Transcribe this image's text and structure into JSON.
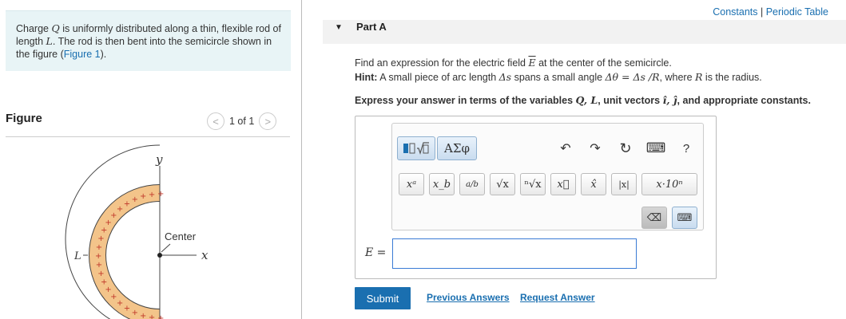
{
  "intro": {
    "t1": "Charge ",
    "q": "Q",
    "t2": " is uniformly distributed along a thin, flexible rod of length ",
    "l": "L",
    "t3": ". The rod is then bent into the semicircle shown in the figure (",
    "link": "Figure 1",
    "t4": ")."
  },
  "figure": {
    "title": "Figure",
    "pager": "1 of 1",
    "prev_glyph": "<",
    "next_glyph": ">",
    "labels": {
      "y": "y",
      "x": "x",
      "center": "Center",
      "L": "L"
    },
    "plus_sign": "+"
  },
  "top_links": {
    "constants": "Constants",
    "sep": " | ",
    "periodic": "Periodic Table"
  },
  "part": {
    "caret": "▼",
    "label": "Part A"
  },
  "question": {
    "line1_a": "Find an expression for the electric field ",
    "E": "E",
    "line1_b": " at the center of the semicircle.",
    "hint_label": "Hint:",
    "hint_a": " A small piece of arc length ",
    "delta_s": "Δs",
    "hint_b": " spans a small angle ",
    "delta_theta_eq": "Δθ = Δs /R",
    "hint_c": ", where ",
    "R": "R",
    "hint_d": " is the radius."
  },
  "express": {
    "a": "Express your answer in terms of the variables ",
    "vars": "Q, L",
    "b": ", unit vectors ",
    "units": "î, ĵ",
    "c": ", and appropriate constants."
  },
  "toolbar": {
    "greek": "ΑΣφ",
    "undo": "↶",
    "redo": "↷",
    "reset": "↻",
    "keyboard": "⌨",
    "help": "?",
    "sup": "xᵃ",
    "sub": "x_b",
    "frac": "a/b",
    "sqrt": "√x",
    "nroot": "ⁿ√x",
    "vec": "x⃗",
    "hat": "x̂",
    "abs": "|x|",
    "sci": "x·10ⁿ",
    "delete": "⌫",
    "kbd2": "⌨"
  },
  "answer": {
    "label": "E ="
  },
  "actions": {
    "submit": "Submit",
    "previous": "Previous Answers",
    "request": "Request Answer"
  }
}
